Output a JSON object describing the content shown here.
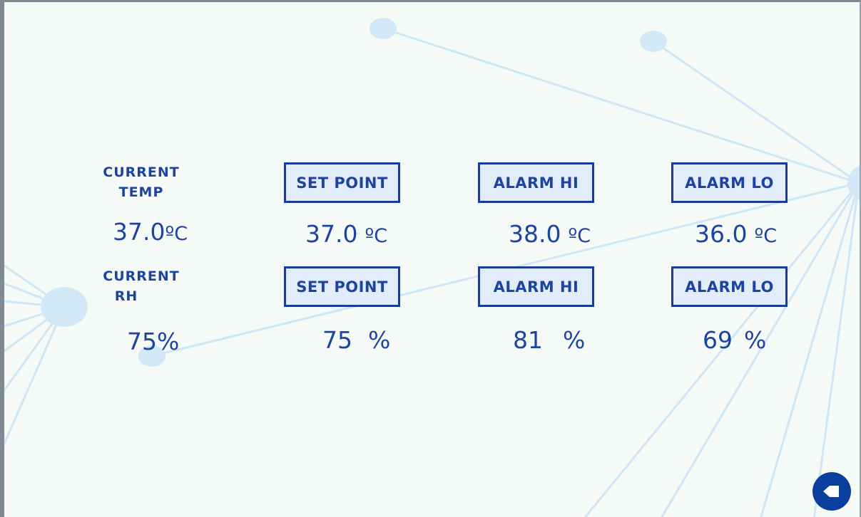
{
  "temp": {
    "current_label_line1": "CURRENT",
    "current_label_line2": "TEMP",
    "current_value": "37.0",
    "current_unit": "ºC",
    "set_point_label": "SET POINT",
    "set_point_value": "37.0",
    "set_point_unit": "ºC",
    "alarm_hi_label": "ALARM HI",
    "alarm_hi_value": "38.0",
    "alarm_hi_unit": "ºC",
    "alarm_lo_label": "ALARM LO",
    "alarm_lo_value": "36.0",
    "alarm_lo_unit": "ºC"
  },
  "rh": {
    "current_label_line1": "CURRENT",
    "current_label_line2": "RH",
    "current_value": "75",
    "current_unit": "%",
    "set_point_label": "SET POINT",
    "set_point_value": "75",
    "set_point_unit": "%",
    "alarm_hi_label": "ALARM HI",
    "alarm_hi_value": "81",
    "alarm_hi_unit": "%",
    "alarm_lo_label": "ALARM LO",
    "alarm_lo_value": "69",
    "alarm_lo_unit": "%"
  },
  "nav": {
    "back_icon": "back-arrow-icon"
  },
  "colors": {
    "background": "#f6faf7",
    "text": "#1d44a0",
    "button_fill": "#e2ecfa",
    "button_border": "#1a3c98",
    "decor": "#d3e9f8",
    "back_button": "#0b3f9e"
  }
}
